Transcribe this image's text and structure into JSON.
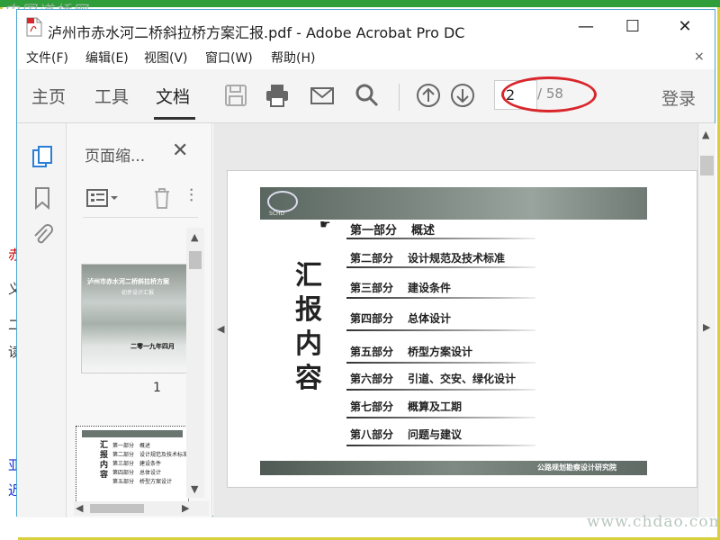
{
  "watermark_top": "中国道桥网",
  "watermark_bottom": "www.chdao.com",
  "window": {
    "title": "泸州市赤水河二桥斜拉桥方案汇报.pdf - Adobe Acrobat Pro DC",
    "minimize": "—",
    "maximize": "☐",
    "close": "✕"
  },
  "menu": [
    "文件(F)",
    "编辑(E)",
    "视图(V)",
    "窗口(W)",
    "帮助(H)"
  ],
  "menu_close": "×",
  "toolbar": {
    "tabs": [
      "主页",
      "工具",
      "文档"
    ],
    "active_tab": "文档",
    "page_current": "2",
    "page_total": "/ 58",
    "login": "登录",
    "accent_red": "#d9262b"
  },
  "thumbnails_panel": {
    "title": "页面缩...",
    "close": "✕",
    "thumb1_title": "泸州市赤水河二桥斜拉桥方案",
    "thumb1_subtitle": "初步设计汇报",
    "thumb1_date": "二零一九年四月",
    "thumb1_page": "1",
    "thumb2_lines": [
      "第一部分　概述",
      "第二部分　设计规范及技术标准",
      "第三部分　建设条件",
      "第四部分　总体设计",
      "第五部分　桥型方案设计"
    ],
    "thumb2_title": "汇报内容"
  },
  "slide": {
    "title": "汇报内容",
    "items": [
      {
        "part": "第一部分",
        "text": "概述"
      },
      {
        "part": "第二部分",
        "text": "设计规范及技术标准"
      },
      {
        "part": "第三部分",
        "text": "建设条件"
      },
      {
        "part": "第四部分",
        "text": "总体设计"
      },
      {
        "part": "第五部分",
        "text": "桥型方案设计"
      },
      {
        "part": "第六部分",
        "text": "引道、交安、绿化设计"
      },
      {
        "part": "第七部分",
        "text": "概算及工期"
      },
      {
        "part": "第八部分",
        "text": "问题与建议"
      }
    ],
    "institute": "公路规划勘察设计研究院",
    "logo_text": "SCHD"
  },
  "left_strip_chars": [
    "赤",
    "义",
    "读",
    "二",
    "亚",
    "迟"
  ]
}
